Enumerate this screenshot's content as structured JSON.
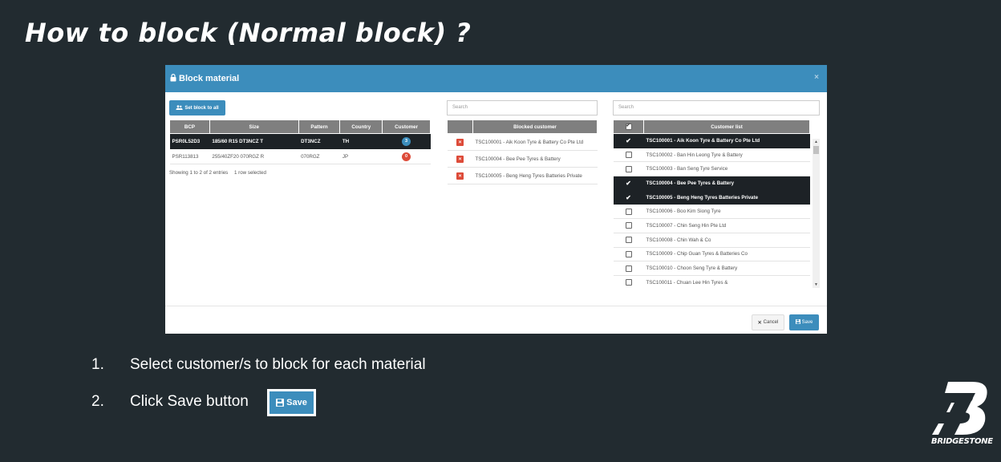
{
  "slide": {
    "title": "How to block (Normal block) ?",
    "steps": [
      {
        "num": "1.",
        "text": "Select customer/s to block for each material"
      },
      {
        "num": "2.",
        "text": "Click Save button"
      }
    ],
    "inline_save_label": "Save",
    "logo_text": "BRIDGESTONE"
  },
  "modal": {
    "title": "Block material",
    "close": "×",
    "set_block_label": "Set block to all",
    "material_table": {
      "headers": [
        "BCP",
        "Size",
        "Pattern",
        "Country",
        "Customer"
      ],
      "rows": [
        {
          "bcp": "PSR0L52D3",
          "size": "185/60 R15 DT3NCZ T",
          "pattern": "DT3NCZ",
          "country": "TH",
          "customer": "3",
          "selected": true
        },
        {
          "bcp": "PSR113813",
          "size": "255/40ZF20 070RGZ R",
          "pattern": "070RGZ",
          "country": "JP",
          "customer": "0",
          "selected": false
        }
      ],
      "info": "Showing 1 to 2 of 2 entries",
      "selected_info": "1 row selected"
    },
    "blocked": {
      "search_placeholder": "Search",
      "header": "Blocked customer",
      "rows": [
        "TSC100001 - Aik Koon Tyre & Battery Co Pte Ltd",
        "TSC100004 - Bee Pee Tyres & Battery",
        "TSC100005 - Beng Heng Tyres Batteries Private"
      ]
    },
    "customers": {
      "search_placeholder": "Search",
      "header": "Customer list",
      "rows": [
        {
          "name": "TSC100001 - Aik Koon Tyre & Battery Co Pte Ltd",
          "checked": true
        },
        {
          "name": "TSC100002 - Ban Hin Leong Tyre & Battery",
          "checked": false
        },
        {
          "name": "TSC100003 - Ban Seng Tyre Service",
          "checked": false
        },
        {
          "name": "TSC100004 - Bee Pee Tyres & Battery",
          "checked": true
        },
        {
          "name": "TSC100005 - Beng Heng Tyres Batteries Private",
          "checked": true
        },
        {
          "name": "TSC100006 - Boo Kim Siong Tyre",
          "checked": false
        },
        {
          "name": "TSC100007 - Chin Seng Hin Pte Ltd",
          "checked": false
        },
        {
          "name": "TSC100008 - Chin Wah & Co",
          "checked": false
        },
        {
          "name": "TSC100009 - Chip Guan Tyres & Batteries Co",
          "checked": false
        },
        {
          "name": "TSC100010 - Choon Seng Tyre & Battery",
          "checked": false
        },
        {
          "name": "TSC100011 - Chuan Lee Hin Tyres &",
          "checked": false
        }
      ]
    },
    "cancel_label": "Cancel",
    "save_label": "Save"
  },
  "colors": {
    "background": "#222b30",
    "accent": "#3c8dbc",
    "danger": "#dd4b39",
    "selected_row": "#1d2226"
  }
}
